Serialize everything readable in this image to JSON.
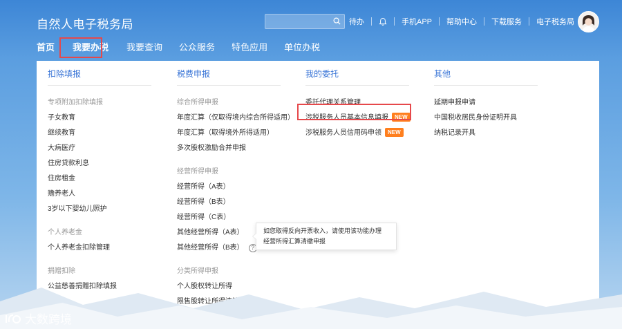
{
  "header": {
    "logo": "自然人电子税务局",
    "search_placeholder": "",
    "links": [
      "待办",
      "手机APP",
      "帮助中心",
      "下载服务",
      "电子税务局"
    ]
  },
  "nav": {
    "items": [
      "首页",
      "我要办税",
      "我要查询",
      "公众服务",
      "特色应用",
      "单位办税"
    ],
    "active_index": 1
  },
  "menu": {
    "col1": {
      "title": "扣除填报",
      "group1": "专项附加扣除填报",
      "group1_items": [
        "子女教育",
        "继续教育",
        "大病医疗",
        "住房贷款利息",
        "住房租金",
        "赡养老人",
        "3岁以下婴幼儿照护"
      ],
      "group2": "个人养老金",
      "group2_items": [
        "个人养老金扣除管理"
      ],
      "group3": "捐赠扣除",
      "group3_items": [
        "公益慈善捐赠扣除填报"
      ]
    },
    "col2": {
      "title": "税费申报",
      "group1": "综合所得申报",
      "group1_items": [
        "年度汇算（仅取得境内综合所得适用）",
        "年度汇算（取得境外所得适用）",
        "多次股权激励合并申报"
      ],
      "group2": "经营所得申报",
      "group2_items": [
        "经营所得（A表）",
        "经营所得（B表）",
        "经营所得（C表）",
        "其他经营所得（A表）",
        "其他经营所得（B表）"
      ],
      "group3": "分类所得申报",
      "group3_items": [
        "个人股权转让所得",
        "限售股转让所得清算申报"
      ]
    },
    "col3": {
      "title": "我的委托",
      "items": [
        "委托代理关系管理",
        "涉税服务人员基本信息填报",
        "涉税服务人员信用码申领"
      ],
      "new_badge": "NEW"
    },
    "col4": {
      "title": "其他",
      "items": [
        "延期申报申请",
        "中国税收居民身份证明开具",
        "纳税记录开具"
      ]
    }
  },
  "tooltip": {
    "line1": "如您取得反向开票收入，请使用该功能办理",
    "line2": "经营所得汇算清缴申报"
  },
  "watermark": "大数跨境",
  "colors": {
    "accent": "#3773d6",
    "highlight_border": "#e6484b",
    "new_badge": "#ff7f1e"
  }
}
